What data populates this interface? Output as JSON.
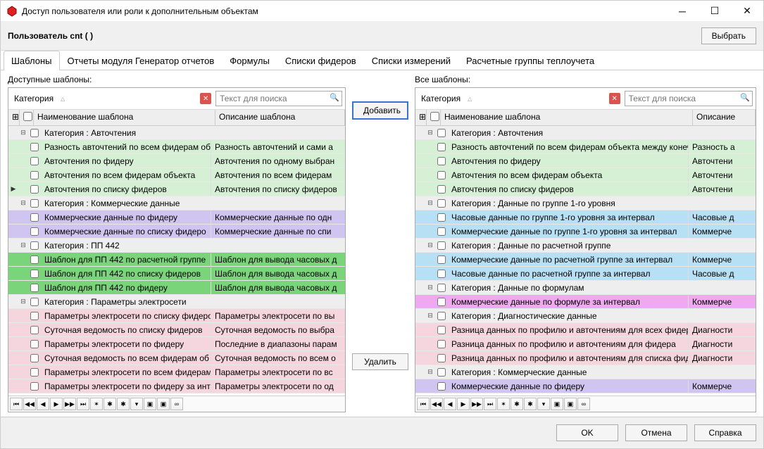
{
  "window": {
    "title": "Доступ пользователя или роли к дополнительным объектам"
  },
  "header": {
    "label": "Пользователь cnt ( )",
    "select_btn": "Выбрать"
  },
  "tabs": [
    "Шаблоны",
    "Отчеты модуля Генератор отчетов",
    "Формулы",
    "Списки фидеров",
    "Списки измерений",
    "Расчетные группы теплоучета"
  ],
  "left_panel": {
    "title": "Доступные шаблоны:",
    "filter_label": "Категория",
    "search_placeholder": "Текст для поиска",
    "col_name": "Наименование шаблона",
    "col_desc": "Описание шаблона"
  },
  "right_panel": {
    "title": "Все шаблоны:",
    "filter_label": "Категория",
    "search_placeholder": "Текст для поиска",
    "col_name": "Наименование шаблона",
    "col_desc": "Описание"
  },
  "middle": {
    "add": "Добавить",
    "remove": "Удалить"
  },
  "footer": {
    "ok": "OK",
    "cancel": "Отмена",
    "help": "Справка"
  },
  "left_rows": [
    {
      "type": "cat",
      "label": "Категория : Авточтения"
    },
    {
      "type": "item",
      "bg": "bg-green-l",
      "name": "Разность авточтений по всем фидерам об",
      "desc": "Разность авточтений и сами а"
    },
    {
      "type": "item",
      "bg": "bg-green-l",
      "name": "Авточтения по фидеру",
      "desc": "Авточтения по одному выбран"
    },
    {
      "type": "item",
      "bg": "bg-green-l",
      "name": "Авточтения по всем фидерам объекта",
      "desc": "Авточтения по всем фидерам"
    },
    {
      "type": "item",
      "bg": "bg-green-l",
      "name": "Авточтения по списку фидеров",
      "desc": "Авточтения по списку фидеров",
      "marker": true
    },
    {
      "type": "cat",
      "label": "Категория : Коммерческие данные"
    },
    {
      "type": "item",
      "bg": "bg-purple",
      "name": "Коммерческие данные по фидеру",
      "desc": "Коммерческие данные по одн"
    },
    {
      "type": "item",
      "bg": "bg-purple",
      "name": "Коммерческие данные по списку фидеро",
      "desc": "Коммерческие данные по спи"
    },
    {
      "type": "cat",
      "label": "Категория : ПП 442"
    },
    {
      "type": "item",
      "bg": "bg-green-d",
      "name": "Шаблон для ПП 442 по расчетной группе",
      "desc": "Шаблон для вывода часовых д"
    },
    {
      "type": "item",
      "bg": "bg-green-d",
      "name": "Шаблон для ПП 442 по списку фидеров",
      "desc": "Шаблон для вывода часовых д"
    },
    {
      "type": "item",
      "bg": "bg-green-d",
      "name": "Шаблон для ПП 442 по фидеру",
      "desc": "Шаблон для вывода часовых д"
    },
    {
      "type": "cat",
      "label": "Категория : Параметры электросети"
    },
    {
      "type": "item",
      "bg": "bg-pink",
      "name": "Параметры электросети по списку фидеро",
      "desc": "Параметры электросети по вы"
    },
    {
      "type": "item",
      "bg": "bg-pink",
      "name": "Суточная ведомость по списку фидеров",
      "desc": "Суточная ведомость по выбра"
    },
    {
      "type": "item",
      "bg": "bg-pink",
      "name": "Параметры электросети по фидеру",
      "desc": "Последние в диапазоны парам"
    },
    {
      "type": "item",
      "bg": "bg-pink",
      "name": "Суточная ведомость по всем фидерам об",
      "desc": "Суточная ведомость по всем о"
    },
    {
      "type": "item",
      "bg": "bg-pink",
      "name": "Параметры электросети по всем фидерам",
      "desc": "Параметры электросети по вс"
    },
    {
      "type": "item",
      "bg": "bg-pink",
      "name": "Параметры электросети по фидеру за инте",
      "desc": "Параметры электросети по од"
    }
  ],
  "right_rows": [
    {
      "type": "cat",
      "label": "Категория : Авточтения"
    },
    {
      "type": "item",
      "bg": "bg-green-l",
      "name": "Разность авточтений по всем фидерам объекта между конечн",
      "desc": "Разность а"
    },
    {
      "type": "item",
      "bg": "bg-green-l",
      "name": "Авточтения по фидеру",
      "desc": "Авточтени"
    },
    {
      "type": "item",
      "bg": "bg-green-l",
      "name": "Авточтения по всем фидерам объекта",
      "desc": "Авточтени"
    },
    {
      "type": "item",
      "bg": "bg-green-l",
      "name": "Авточтения по списку фидеров",
      "desc": "Авточтени"
    },
    {
      "type": "cat",
      "label": "Категория : Данные по группе 1-го уровня"
    },
    {
      "type": "item",
      "bg": "bg-blue",
      "name": "Часовые данные по группе 1-го уровня за интервал",
      "desc": "Часовые д"
    },
    {
      "type": "item",
      "bg": "bg-blue",
      "name": "Коммерческие данные по группе 1-го уровня за интервал",
      "desc": "Коммерче"
    },
    {
      "type": "cat",
      "label": "Категория : Данные по расчетной группе"
    },
    {
      "type": "item",
      "bg": "bg-blue",
      "name": "Коммерческие данные по расчетной группе за интервал",
      "desc": "Коммерче"
    },
    {
      "type": "item",
      "bg": "bg-blue",
      "name": "Часовые данные по расчетной группе за интервал",
      "desc": "Часовые д"
    },
    {
      "type": "cat",
      "label": "Категория : Данные по формулам"
    },
    {
      "type": "item",
      "bg": "bg-magenta",
      "name": "Коммерческие данные по формуле за интервал",
      "desc": "Коммерче"
    },
    {
      "type": "cat",
      "label": "Категория : Диагностические данные"
    },
    {
      "type": "item",
      "bg": "bg-pink",
      "name": "Разница данных по профилю и авточтениям для всех фидеро",
      "desc": "Диагности"
    },
    {
      "type": "item",
      "bg": "bg-pink",
      "name": "Разница данных по профилю и авточтениям для фидера",
      "desc": "Диагности"
    },
    {
      "type": "item",
      "bg": "bg-pink",
      "name": "Разница данных по профилю и авточтениям для списка фиде",
      "desc": "Диагности"
    },
    {
      "type": "cat",
      "label": "Категория : Коммерческие данные"
    },
    {
      "type": "item",
      "bg": "bg-purple",
      "name": "Коммерческие данные по фидеру",
      "desc": "Коммерче"
    }
  ],
  "nav_glyphs": [
    "⏮",
    "◀◀",
    "◀",
    "▶",
    "▶▶",
    "⏭",
    "✶",
    "✱",
    "✱",
    "▾",
    "▣",
    "▣",
    "∞"
  ]
}
